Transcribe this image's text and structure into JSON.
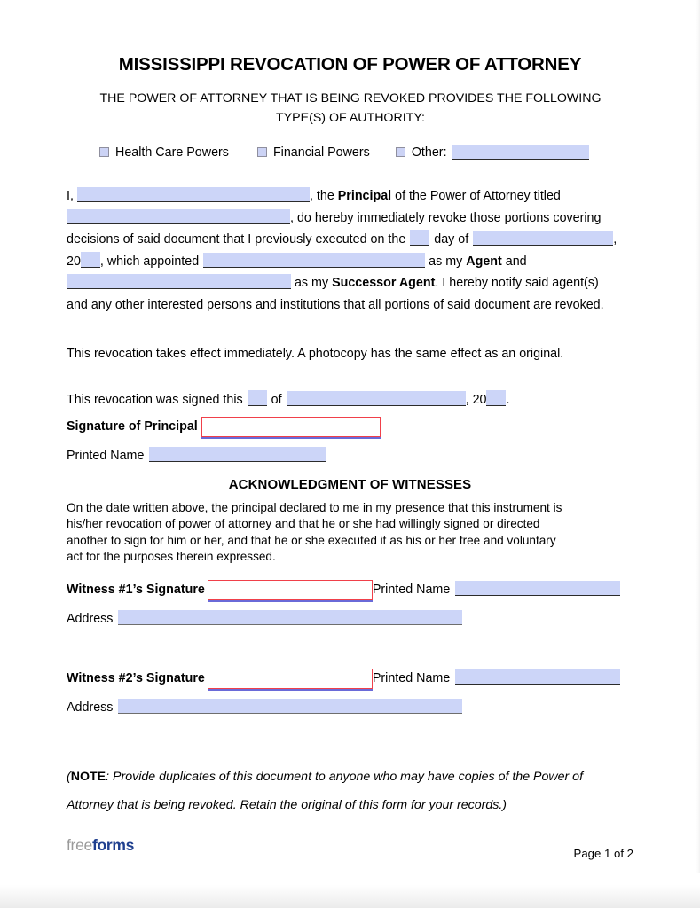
{
  "document": {
    "title": "MISSISSIPPI REVOCATION OF POWER OF ATTORNEY",
    "subtitle": "THE POWER OF ATTORNEY THAT IS BEING REVOKED PROVIDES THE FOLLOWING TYPE(S) OF AUTHORITY:"
  },
  "authority_types": {
    "options": [
      {
        "label": "Health Care Powers",
        "checked": false
      },
      {
        "label": "Financial Powers",
        "checked": false
      },
      {
        "label": "Other:",
        "checked": false
      }
    ],
    "other_value": ""
  },
  "body": {
    "line1_prefix": "I,",
    "principal_name_value": "",
    "line1_suffix_a": ", the ",
    "line1_bold": "Principal",
    "line1_suffix_b": " of the Power of Attorney titled",
    "poa_title_value": "",
    "line2_suffix": ", do hereby immediately revoke those portions covering",
    "line3_prefix": "decisions of said document that I previously executed on the",
    "day_value": "",
    "line3_mid": "day of",
    "month_value": "",
    "line3_comma": ",",
    "year_prefix": "20",
    "year_value": "",
    "line4_mid": ", which appointed",
    "agent_name_value": "",
    "line4_suffix_a": " as my ",
    "line4_bold": "Agent",
    "line4_suffix_b": " and",
    "successor_name_value": "",
    "line5_suffix_a": " as my ",
    "line5_bold": "Successor Agent",
    "line5_suffix_b": ". I hereby notify said agent(s)",
    "line6": "and any other interested persons and institutions that all portions of said document are revoked."
  },
  "effect_paragraph": "This revocation takes effect immediately. A photocopy has the same effect as an original.",
  "signing": {
    "signed_prefix": "This revocation was signed this",
    "signed_day_value": "",
    "signed_of": "of",
    "signed_month_value": "",
    "signed_comma": ",",
    "signed_year_prefix": "20",
    "signed_year_value": "",
    "signed_period": ".",
    "signature_label": "Signature of Principal",
    "signature_value": "",
    "printed_name_label": "Printed Name",
    "printed_name_value": ""
  },
  "acknowledgment": {
    "heading": "ACKNOWLEDGMENT OF WITNESSES",
    "paragraph": "On the date written above, the principal declared to me in my presence that this instrument is his/her revocation of power of attorney and that he or she had willingly signed or directed another to sign for him or her, and that he or she executed it as his or her free and voluntary act for the purposes therein expressed."
  },
  "witnesses": [
    {
      "signature_label": "Witness #1’s Signature",
      "signature_value": "",
      "printed_name_label": "Printed Name",
      "printed_name_value": "",
      "address_label": "Address",
      "address_value": ""
    },
    {
      "signature_label": "Witness #2’s Signature",
      "signature_value": "",
      "printed_name_label": "Printed Name",
      "printed_name_value": "",
      "address_label": "Address",
      "address_value": ""
    }
  ],
  "note": {
    "open_paren": "(",
    "label": "NOTE",
    "text": ": Provide duplicates of this document to anyone who may have copies of the Power of Attorney that is being revoked. Retain the original of this form for your records.)"
  },
  "footer": {
    "logo_first": "free",
    "logo_second": "forms",
    "page_indicator": "Page 1 of 2"
  },
  "colors": {
    "field_fill": "#ccd5f8",
    "field_underline": "#2b2b2b",
    "signature_border": "#f0404a",
    "signature_underline": "#6a6ad8",
    "logo_gray": "#9a9a9a",
    "logo_blue": "#1f3f8f"
  }
}
